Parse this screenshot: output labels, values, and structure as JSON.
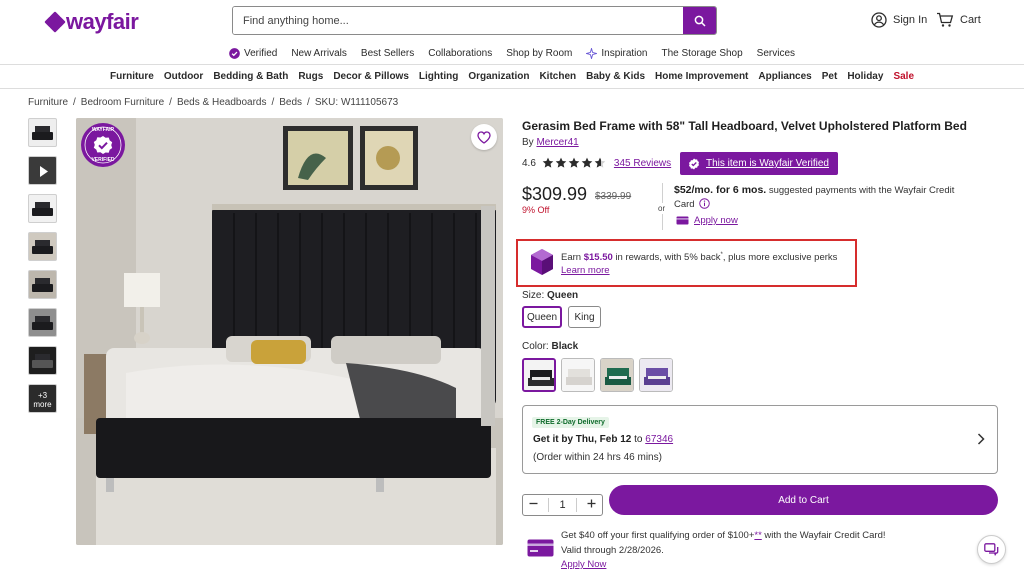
{
  "brand": {
    "name": "wayfair"
  },
  "search": {
    "placeholder": "Find anything home..."
  },
  "header": {
    "sign_in": "Sign In",
    "cart": "Cart"
  },
  "subnav": [
    "Verified",
    "New Arrivals",
    "Best Sellers",
    "Collaborations",
    "Shop by Room",
    "Inspiration",
    "The Storage Shop",
    "Services"
  ],
  "categories": [
    "Furniture",
    "Outdoor",
    "Bedding & Bath",
    "Rugs",
    "Decor & Pillows",
    "Lighting",
    "Organization",
    "Kitchen",
    "Baby & Kids",
    "Home Improvement",
    "Appliances",
    "Pet",
    "Holiday",
    "Sale"
  ],
  "breadcrumb": [
    "Furniture",
    "Bedroom Furniture",
    "Beds & Headboards",
    "Beds",
    "SKU: W111105673"
  ],
  "thumbnails": {
    "more_label": "+3 more"
  },
  "image_badge": {
    "top_text": "WAYFAIR",
    "bottom_text": "VERIFIED"
  },
  "product": {
    "title": "Gerasim Bed Frame with 58\" Tall Headboard, Velvet Upholstered Platform Bed",
    "by_prefix": "By",
    "brand": "Mercer41",
    "rating": "4.6",
    "rating_value": 4.6,
    "reviews": "345 Reviews",
    "verified_pill": "This item is Wayfair Verified",
    "price": "$309.99",
    "old_price": "$339.99",
    "discount": "9% Off",
    "or": "or"
  },
  "credit": {
    "monthly": "$52/mo. for 6 mos.",
    "text_a": "suggested payments with the Wayfair Credit",
    "text_b": "Card",
    "apply": "Apply now"
  },
  "rewards": {
    "earn": "Earn",
    "amount": "$15.50",
    "rest": "in rewards, with 5% back",
    "sup": "*",
    "tail": ", plus more exclusive perks",
    "learn_more": "Learn more"
  },
  "size": {
    "label": "Size:",
    "selected": "Queen",
    "options": [
      "Queen",
      "King"
    ]
  },
  "color": {
    "label": "Color:",
    "selected": "Black"
  },
  "delivery": {
    "badge": "FREE 2-Day Delivery",
    "get_it": "Get it by Thu, Feb 12",
    "to": "to",
    "zip": "67346",
    "order_within": "(Order within 24 hrs 46 mins)"
  },
  "quantity": {
    "value": "1"
  },
  "add_to_cart": "Add to Cart",
  "promo": {
    "line1_a": "Get $40 off your first qualifying order of $100+",
    "line1_star": "**",
    "line1_b": " with the Wayfair Credit Card!",
    "line2": "Valid through 2/28/2026.",
    "apply": "Apply Now"
  },
  "colors": {
    "brand": "#7b189f",
    "sale": "#c0112c",
    "highlight": "#d62d2d"
  }
}
